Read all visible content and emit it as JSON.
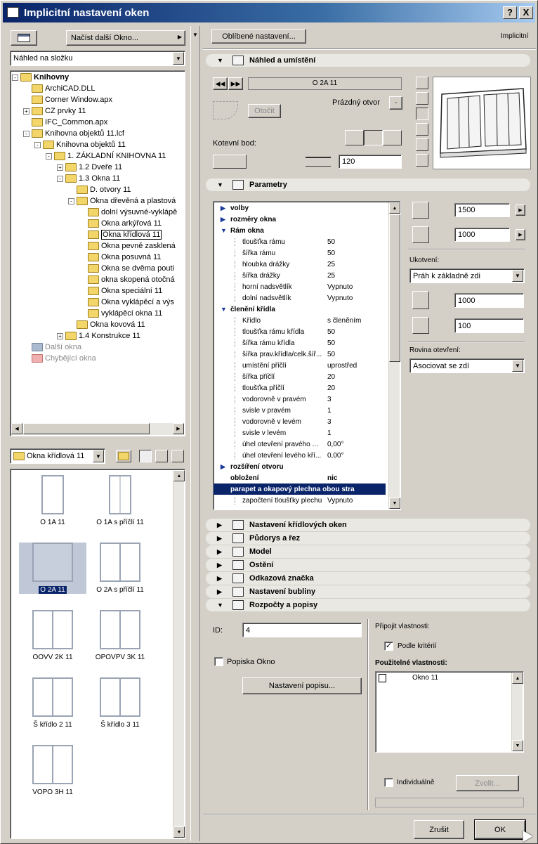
{
  "window": {
    "title": "Implicitní nastavení oken",
    "help": "?",
    "close": "X"
  },
  "left": {
    "load_more": "Načíst další Okno...",
    "view_select": "Náhled na složku",
    "tree": [
      {
        "label": "Knihovny",
        "level": 0,
        "pm": "-",
        "bold": true,
        "kind": "folder"
      },
      {
        "label": "ArchiCAD.DLL",
        "level": 1,
        "pm": "",
        "kind": "folder"
      },
      {
        "label": "Corner Window.apx",
        "level": 1,
        "pm": "",
        "kind": "folder"
      },
      {
        "label": "CZ prvky 11",
        "level": 1,
        "pm": "+",
        "kind": "folder"
      },
      {
        "label": "IFC_Common.apx",
        "level": 1,
        "pm": "",
        "kind": "folder"
      },
      {
        "label": "Knihovna objektů 11.lcf",
        "level": 1,
        "pm": "-",
        "kind": "folder"
      },
      {
        "label": "Knihovna objektů 11",
        "level": 2,
        "pm": "-",
        "kind": "folder"
      },
      {
        "label": "1. ZÁKLADNÍ KNIHOVNA 11",
        "level": 3,
        "pm": "-",
        "kind": "folder"
      },
      {
        "label": "1.2 Dveře 11",
        "level": 4,
        "pm": "+",
        "kind": "folder"
      },
      {
        "label": "1.3 Okna 11",
        "level": 4,
        "pm": "-",
        "kind": "folder"
      },
      {
        "label": "D. otvory 11",
        "level": 5,
        "pm": "",
        "kind": "folder"
      },
      {
        "label": "Okna dřevěná a plastová",
        "level": 5,
        "pm": "-",
        "kind": "folder"
      },
      {
        "label": "dolní výsuvné-vyklápě",
        "level": 6,
        "pm": "",
        "kind": "folder"
      },
      {
        "label": "Okna arkýřová 11",
        "level": 6,
        "pm": "",
        "kind": "folder"
      },
      {
        "label": "Okna křídlová 11",
        "level": 6,
        "pm": "",
        "kind": "folder",
        "selected": true
      },
      {
        "label": "Okna pevně zasklená",
        "level": 6,
        "pm": "",
        "kind": "folder"
      },
      {
        "label": "Okna posuvná 11",
        "level": 6,
        "pm": "",
        "kind": "folder"
      },
      {
        "label": "Okna se dvěma pouti",
        "level": 6,
        "pm": "",
        "kind": "folder"
      },
      {
        "label": "okna skopená otočná",
        "level": 6,
        "pm": "",
        "kind": "folder"
      },
      {
        "label": "Okna speciální 11",
        "level": 6,
        "pm": "",
        "kind": "folder"
      },
      {
        "label": "Okna vyklápěcí a výs",
        "level": 6,
        "pm": "",
        "kind": "folder"
      },
      {
        "label": "vyklápěcí okna 11",
        "level": 6,
        "pm": "",
        "kind": "folder"
      },
      {
        "label": "Okna kovová 11",
        "level": 5,
        "pm": "",
        "kind": "folder"
      },
      {
        "label": "1.4 Konstrukce 11",
        "level": 4,
        "pm": "+",
        "kind": "folder"
      },
      {
        "label": "Další okna",
        "level": 1,
        "pm": "",
        "kind": "gray"
      },
      {
        "label": "Chybějící okna",
        "level": 1,
        "pm": "",
        "kind": "pink"
      }
    ],
    "folder_select": "Okna křídlová 11",
    "thumbs": [
      {
        "label": "O 1A 11"
      },
      {
        "label": "O 1A s příčlí 11"
      },
      {
        "label": "O 2A 11",
        "selected": true
      },
      {
        "label": "O 2A s příčlí 11"
      },
      {
        "label": "OOVV 2K 11"
      },
      {
        "label": "OPOVPV 3K 11"
      },
      {
        "label": "Š křídlo 2 11"
      },
      {
        "label": "Š křídlo 3 11"
      },
      {
        "label": "VOPO 3H 11"
      }
    ]
  },
  "right": {
    "favorites": "Oblíbené nastavení...",
    "mode": "Implicitní",
    "sec_preview": "Náhled a umístění",
    "object_name": "O 2A 11",
    "empty_opening": "Prázdný otvor",
    "rotate": "Otočit",
    "anchor_label": "Kotevní bod:",
    "anchor_value": "120",
    "sec_params": "Parametry",
    "params": [
      {
        "n": "volby",
        "v": "",
        "t": "group-c"
      },
      {
        "n": "rozměry okna",
        "v": "",
        "t": "group-c"
      },
      {
        "n": "Rám okna",
        "v": "",
        "t": "group-o"
      },
      {
        "n": "tloušťka rámu",
        "v": "50",
        "t": "sub"
      },
      {
        "n": "šířka rámu",
        "v": "50",
        "t": "sub"
      },
      {
        "n": "hloubka drážky",
        "v": "25",
        "t": "sub"
      },
      {
        "n": "šířka drážky",
        "v": "25",
        "t": "sub"
      },
      {
        "n": "horní nadsvětlík",
        "v": "Vypnuto",
        "t": "sub"
      },
      {
        "n": "dolní nadsvětlík",
        "v": "Vypnuto",
        "t": "sub"
      },
      {
        "n": "členění křídla",
        "v": "",
        "t": "group-o"
      },
      {
        "n": "Křídlo",
        "v": "s členěním",
        "t": "sub"
      },
      {
        "n": "tloušťka rámu křídla",
        "v": "50",
        "t": "sub"
      },
      {
        "n": "šířka rámu křídla",
        "v": "50",
        "t": "sub"
      },
      {
        "n": "šířka prav.křídla/celk.šíř...",
        "v": "50",
        "t": "sub"
      },
      {
        "n": "umístění příčlí",
        "v": "uprostřed",
        "t": "sub"
      },
      {
        "n": "šířka příčlí",
        "v": "20",
        "t": "sub"
      },
      {
        "n": "tloušťka příčlí",
        "v": "20",
        "t": "sub"
      },
      {
        "n": "vodorovně v pravém",
        "v": "3",
        "t": "sub"
      },
      {
        "n": "svisle v pravém",
        "v": "1",
        "t": "sub"
      },
      {
        "n": "vodorovně v levém",
        "v": "3",
        "t": "sub"
      },
      {
        "n": "svisle v levém",
        "v": "1",
        "t": "sub"
      },
      {
        "n": "úhel otevření pravého ...",
        "v": "0,00°",
        "t": "sub"
      },
      {
        "n": "úhel otevření levého kří...",
        "v": "0,00°",
        "t": "sub"
      },
      {
        "n": "rozšíření otvoru",
        "v": "",
        "t": "group-c"
      },
      {
        "n": "obložení",
        "v": "nic",
        "t": "bold"
      },
      {
        "n": "parapet a okapový plechna obou stra",
        "v": "",
        "t": "sel"
      },
      {
        "n": "započtení tloušťky plechu",
        "v": "Vypnuto",
        "t": "sub"
      }
    ],
    "width": "1500",
    "height": "1000",
    "anchoring_label": "Ukotvení:",
    "anchoring_value": "Práh k základně zdi",
    "sill": "1000",
    "reveal": "100",
    "opening_plane_label": "Rovina otevření:",
    "opening_plane_value": "Asociovat se zdí",
    "sections": [
      "Nastavení křídlových oken",
      "Půdorys a řez",
      "Model",
      "Ostění",
      "Odkazová značka",
      "Nastavení bubliny"
    ],
    "sec_listing": "Rozpočty a popisy",
    "id_label": "ID:",
    "id_value": "4",
    "label_checkbox": "Popiska Okno",
    "label_settings": "Nastavení popisu...",
    "attach_props": "Připojit vlastnosti:",
    "by_criteria": "Podle kritérií",
    "available_props": "Použitelné vlastnosti:",
    "prop_item": "Okno 11",
    "individual": "Individuálně",
    "choose": "Zvolit...",
    "cancel": "Zrušit",
    "ok": "OK"
  }
}
